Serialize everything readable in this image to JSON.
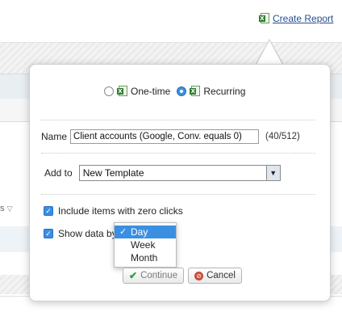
{
  "header": {
    "create_report_label": "Create Report",
    "create_report_icon": "excel-icon"
  },
  "table": {
    "column_partial_label": "s"
  },
  "popup": {
    "report_type": {
      "options": [
        {
          "label": "One-time",
          "selected": false
        },
        {
          "label": "Recurring",
          "selected": true
        }
      ]
    },
    "name": {
      "label": "Name",
      "value": "Client accounts (Google, Conv. equals 0)",
      "counter": "(40/512)"
    },
    "add_to": {
      "label": "Add to",
      "value": "New Template"
    },
    "include_zero_clicks": {
      "label": "Include items with zero clicks",
      "checked": true
    },
    "show_data_by": {
      "label": "Show data by",
      "checked": true,
      "options": [
        "Day",
        "Week",
        "Month"
      ],
      "selected": "Day"
    },
    "buttons": {
      "continue_label": "Continue",
      "cancel_label": "Cancel"
    }
  },
  "colors": {
    "accent": "#3b8fe0",
    "link": "#2a4d8f",
    "excel": "#2e7d32"
  }
}
